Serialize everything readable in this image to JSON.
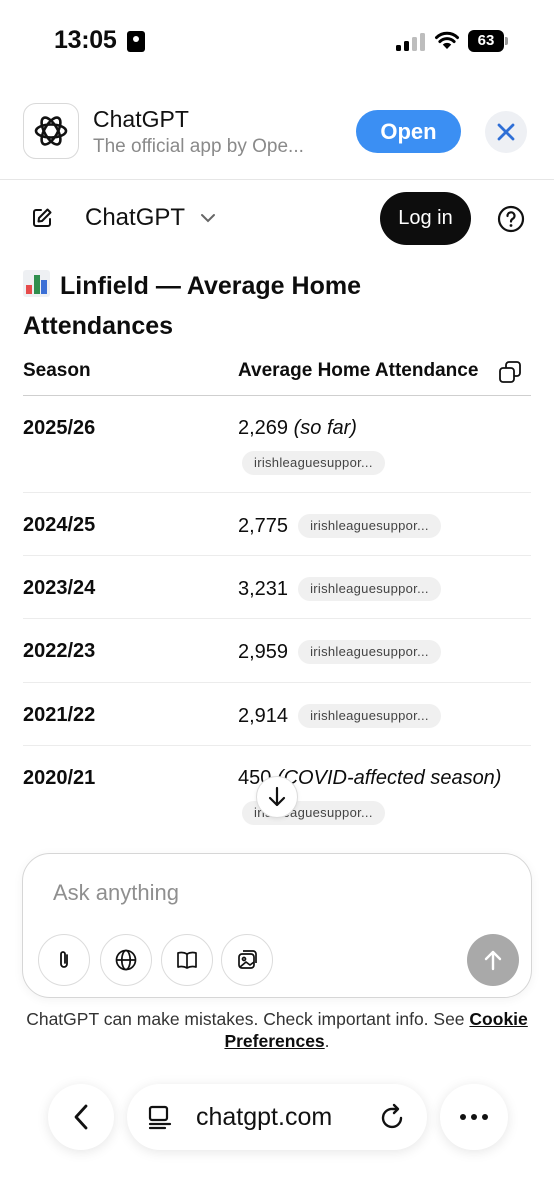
{
  "status_bar": {
    "time": "13:05",
    "battery": "63"
  },
  "app_banner": {
    "app_name": "ChatGPT",
    "subtitle": "The official app by Ope...",
    "open_label": "Open"
  },
  "header": {
    "model": "ChatGPT",
    "login_label": "Log in"
  },
  "content": {
    "heading": "Linfield — Average Home Attendances",
    "columns": [
      "Season",
      "Average Home Attendance"
    ],
    "rows": [
      {
        "season": "2025/26",
        "value": "2,269",
        "note": "(so far)",
        "source": "irishleaguesuppor..."
      },
      {
        "season": "2024/25",
        "value": "2,775",
        "note": "",
        "source": "irishleaguesuppor..."
      },
      {
        "season": "2023/24",
        "value": "3,231",
        "note": "",
        "source": "irishleaguesuppor..."
      },
      {
        "season": "2022/23",
        "value": "2,959",
        "note": "",
        "source": "irishleaguesuppor..."
      },
      {
        "season": "2021/22",
        "value": "2,914",
        "note": "",
        "source": "irishleaguesuppor..."
      },
      {
        "season": "2020/21",
        "value": "450",
        "note": "(COVID-affected season)",
        "source": "irishleaguesuppor..."
      }
    ]
  },
  "composer": {
    "placeholder": "Ask anything"
  },
  "disclaimer": {
    "text": "ChatGPT can make mistakes. Check important info. See",
    "link": "Cookie Preferences",
    "suffix": "."
  },
  "browser": {
    "url": "chatgpt.com"
  },
  "icons": {
    "banner_close": "close-icon",
    "edit": "edit-icon",
    "help": "help-icon",
    "copy": "copy-icon",
    "scroll": "arrow-down-icon",
    "attach": "paperclip-icon",
    "web": "globe-icon",
    "study": "book-icon",
    "image": "image-icon",
    "send": "arrow-up-icon",
    "back": "chevron-left-icon",
    "reader": "reader-icon",
    "reload": "reload-icon",
    "more": "more-icon"
  },
  "colors": {
    "open_button": "#3b8ff3",
    "login_button": "#0d0d0d",
    "send_button": "#a9a9a9"
  }
}
